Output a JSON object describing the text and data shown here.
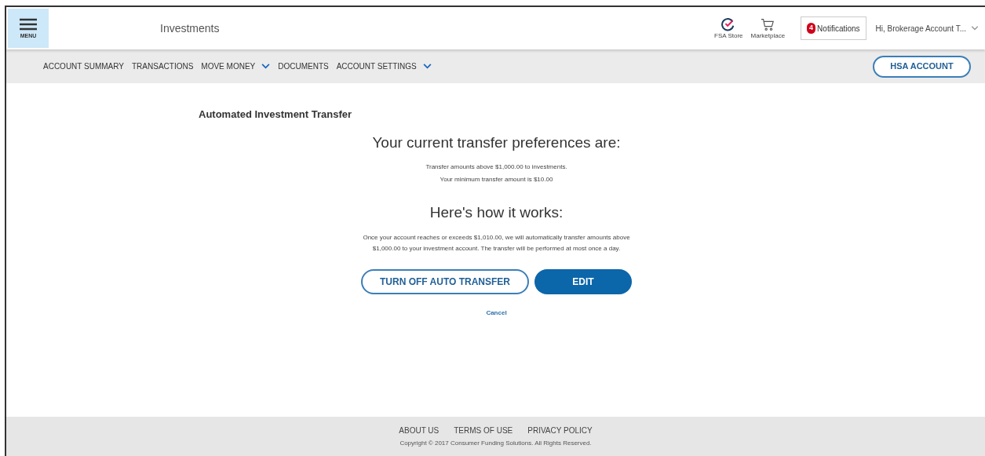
{
  "header": {
    "menu_label": "MENU",
    "title": "Investments",
    "shortcuts": [
      {
        "kind": "store",
        "label": "FSA Store"
      },
      {
        "kind": "cart",
        "label": "Marketplace"
      }
    ],
    "notifications": {
      "count": "4",
      "label": "Notifications"
    },
    "user": "Hi, Brokerage Account T..."
  },
  "nav": {
    "items": [
      {
        "label": "ACCOUNT SUMMARY",
        "kind": "link"
      },
      {
        "label": "TRANSACTIONS",
        "kind": "link"
      },
      {
        "label": "MOVE MONEY",
        "kind": "dropdown"
      },
      {
        "label": "DOCUMENTS",
        "kind": "link"
      },
      {
        "label": "ACCOUNT SETTINGS",
        "kind": "dropdown"
      }
    ],
    "account_button": "HSA ACCOUNT"
  },
  "page": {
    "title": "Automated Investment Transfer",
    "preferences_heading": "Your current transfer preferences are:",
    "preferences": [
      "Transfer amounts above $1,000.00 to investments.",
      "Your minimum transfer amount is $10.00"
    ],
    "how_heading": "Here's how it works:",
    "how_text": "Once your account reaches or exceeds $1,010.00, we will automatically transfer amounts above $1,000.00 to your investment account. The transfer will be performed at most once a day.",
    "buttons": [
      {
        "label": "TURN OFF AUTO TRANSFER",
        "kind": "outline"
      },
      {
        "label": "EDIT",
        "kind": "primary"
      }
    ],
    "cancel": "Cancel"
  },
  "footer": {
    "links": [
      "ABOUT US",
      "TERMS OF USE",
      "PRIVACY POLICY"
    ],
    "copyright": "Copyright © 2017 Consumer Funding Solutions. All Rights Reserved."
  }
}
